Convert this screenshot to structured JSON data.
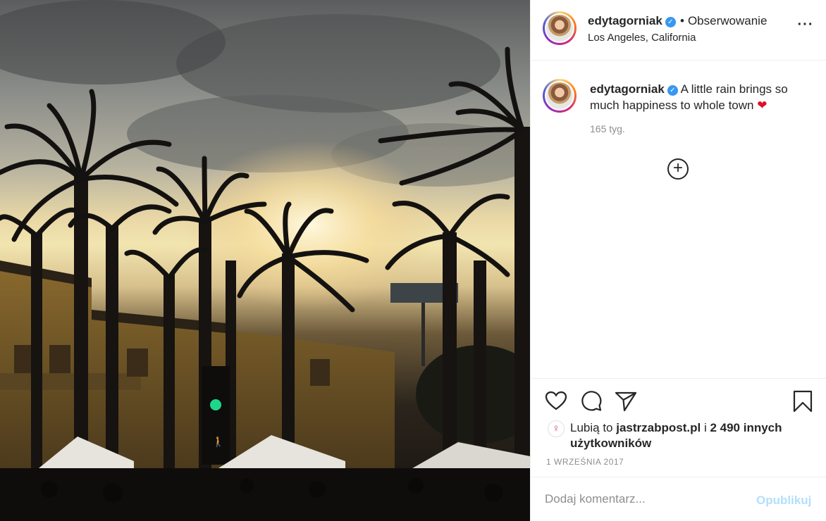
{
  "post": {
    "image_alt": "",
    "author": {
      "username": "edytagorniak",
      "verified": true,
      "follow_status": "Obserwowanie",
      "location": "Los Angeles, California"
    },
    "caption": {
      "username": "edytagorniak",
      "text": "A little rain brings so much happiness to whole town",
      "emoji": "❤"
    },
    "time_ago": "165 tyg.",
    "likes": {
      "prefix": "Lubią to",
      "first_user": "jastrzabpost.pl",
      "conjunction": "i",
      "others": "2 490 innych użytkowników"
    },
    "date": "1 WRZEŚNIA 2017",
    "comment": {
      "placeholder": "Dodaj komentarz...",
      "post_label": "Opublikuj"
    }
  },
  "icons": {
    "more": "more-options-icon",
    "like": "heart-icon",
    "comment": "comment-icon",
    "share": "share-icon",
    "save": "bookmark-icon",
    "expand": "plus-circle-icon"
  },
  "colors": {
    "text": "#262626",
    "muted": "#8e8e8e",
    "verified": "#3897f0",
    "post_button": "#b2dffc",
    "heart": "#e0102a",
    "traffic_light": "#1ed68a"
  }
}
